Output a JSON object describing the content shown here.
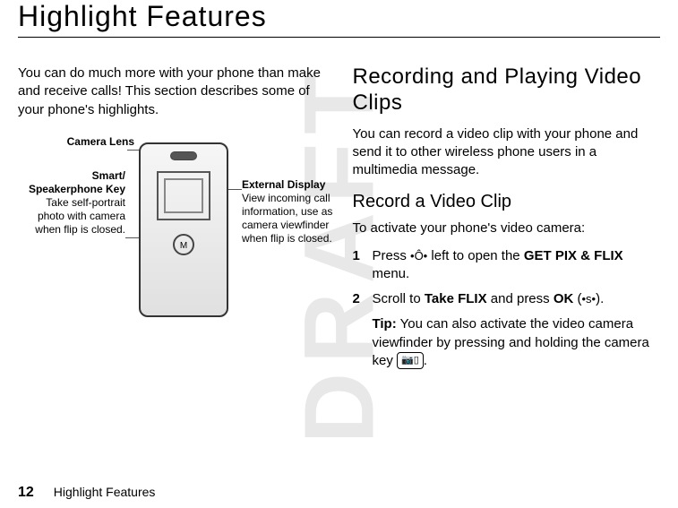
{
  "watermark": "DRAFT",
  "page_title": "Highlight Features",
  "left": {
    "intro": "You can do much more with your phone than make and receive calls! This section describes some of your phone's highlights.",
    "callouts": {
      "lens_label": "Camera Lens",
      "smart_label": "Smart/ Speakerphone Key",
      "smart_desc": "Take self-portrait photo with camera when flip is closed.",
      "ext_label": "External Display",
      "ext_desc": "View incoming call information, use as camera viewfinder when flip is closed."
    },
    "phone_button": "M"
  },
  "right": {
    "section_title": "Recording and Playing Video Clips",
    "section_body": "You can record a video clip with your phone and send it to other wireless phone users in a multimedia message.",
    "subsection_title": "Record a Video Clip",
    "subsection_body": "To activate your phone's video camera:",
    "steps": [
      {
        "num": "1",
        "pre": "Press ",
        "key": "•Ô•",
        "mid": " left to open the ",
        "menu": "GET PIX & FLIX",
        "post": " menu."
      },
      {
        "num": "2",
        "pre": "Scroll to ",
        "menu1": "Take FLIX",
        "mid": " and press ",
        "menu2": "OK",
        "paren_open": " (",
        "key": "•s•",
        "paren_close": ")."
      }
    ],
    "tip_label": "Tip:",
    "tip_text": " You can also activate the video camera viewfinder by pressing and holding the camera key ",
    "tip_key": "📷▯",
    "tip_end": "."
  },
  "footer": {
    "page_num": "12",
    "running": "Highlight Features"
  }
}
